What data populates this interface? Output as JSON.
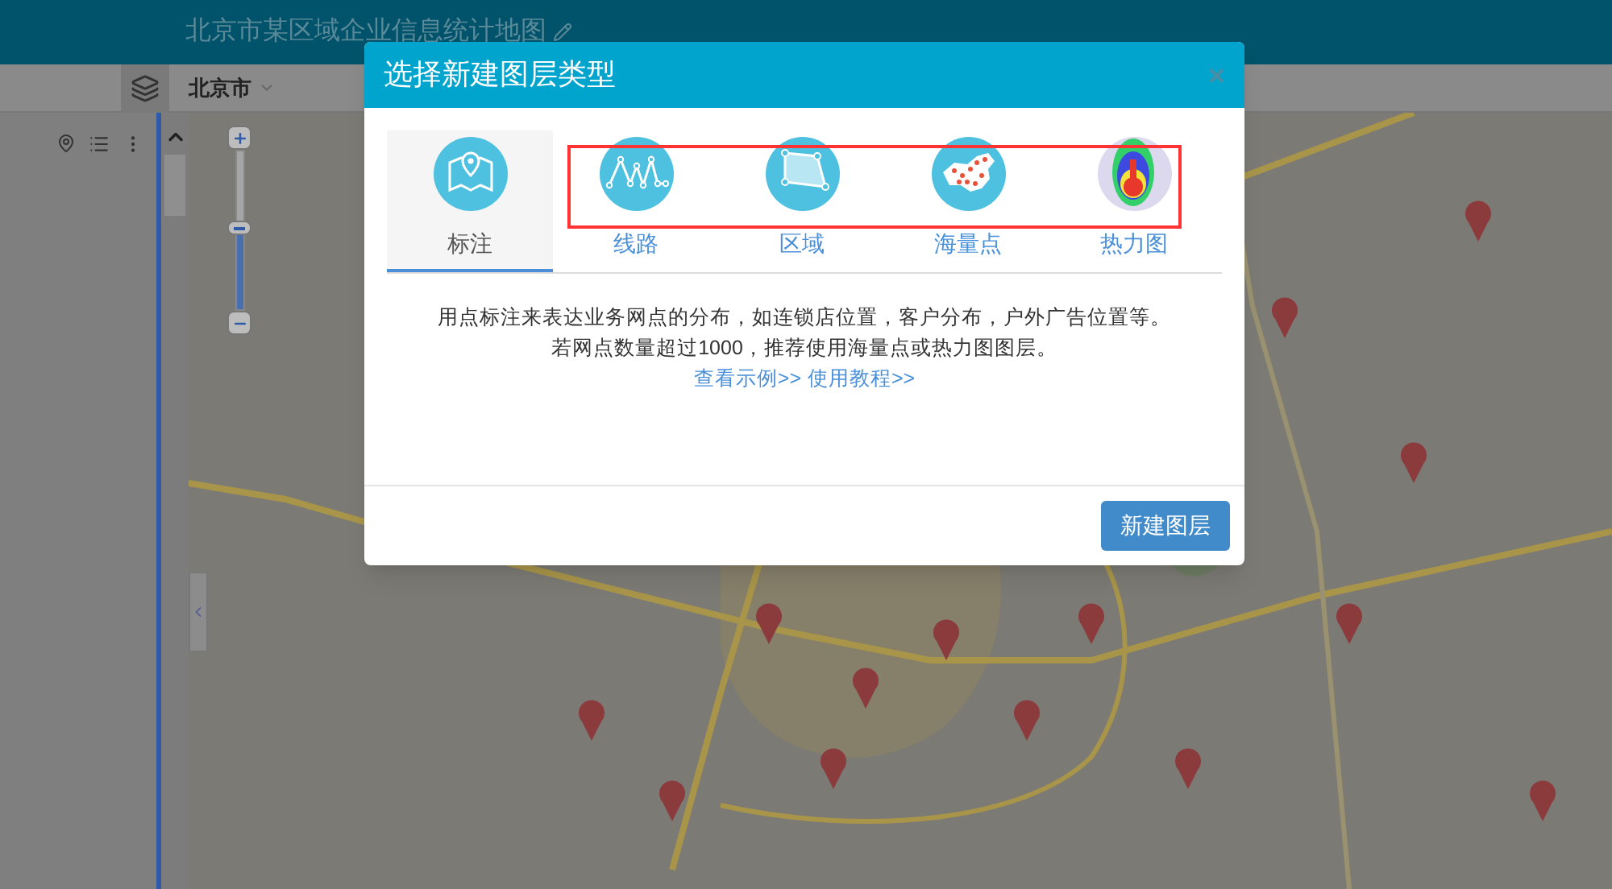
{
  "header": {
    "title": "北京市某区域企业信息统计地图"
  },
  "toolbar": {
    "city": "北京市"
  },
  "zoom": {
    "level": 0.52
  },
  "dialog": {
    "title": "选择新建图层类型",
    "close": "×",
    "layer_types": [
      {
        "label": "标注",
        "kind": "marker",
        "selected": true
      },
      {
        "label": "线路",
        "kind": "line",
        "selected": false
      },
      {
        "label": "区域",
        "kind": "area",
        "selected": false
      },
      {
        "label": "海量点",
        "kind": "mass",
        "selected": false
      },
      {
        "label": "热力图",
        "kind": "heat",
        "selected": false
      }
    ],
    "description": [
      "用点标注来表达业务网点的分布，如连锁店位置，客户分布，户外广告位置等。",
      "若网点数量超过1000，推荐使用海量点或热力图图层。"
    ],
    "links": [
      "查看示例>>",
      "使用教程>>"
    ],
    "create_button": "新建图层"
  }
}
